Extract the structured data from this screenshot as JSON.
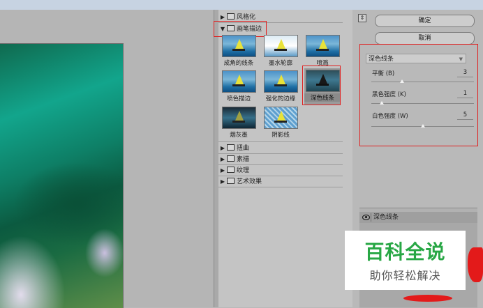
{
  "window": {
    "title": ""
  },
  "gallery": {
    "categories_top": [
      {
        "label": "风格化",
        "expanded": false
      },
      {
        "label": "画笔描边",
        "expanded": true
      }
    ],
    "thumbnails": [
      {
        "label": "成角的线条",
        "style": "normal"
      },
      {
        "label": "墨水轮廓",
        "style": "dark"
      },
      {
        "label": "喷溅",
        "style": "normal"
      },
      {
        "label": "喷色描边",
        "style": "normal"
      },
      {
        "label": "强化的边缘",
        "style": "normal"
      },
      {
        "label": "深色线条",
        "style": "dark",
        "selected": true
      },
      {
        "label": "烟灰墨",
        "style": "smoke"
      },
      {
        "label": "阴影线",
        "style": "hatch"
      }
    ],
    "categories_bottom": [
      {
        "label": "扭曲"
      },
      {
        "label": "素描"
      },
      {
        "label": "纹理"
      },
      {
        "label": "艺术效果"
      }
    ]
  },
  "buttons": {
    "ok": "确定",
    "cancel": "取消"
  },
  "settings": {
    "filter_name": "深色线条",
    "params": [
      {
        "label": "平衡 (B)",
        "value": "3",
        "max": 10
      },
      {
        "label": "黑色强度 (K)",
        "value": "1",
        "max": 10
      },
      {
        "label": "白色强度 (W)",
        "value": "5",
        "max": 10
      }
    ]
  },
  "layers": {
    "items": [
      {
        "name": "深色线条",
        "visible": true
      }
    ]
  },
  "watermark": {
    "title": "百科全说",
    "subtitle": "助你轻松解决"
  },
  "colors": {
    "highlight_box": "#e02020",
    "watermark_green": "#28a745"
  },
  "icons": {
    "collapse": "collapse-toggle-icon",
    "folder": "folder-icon",
    "eye": "eye-icon",
    "chevron": "chevron-down-icon"
  }
}
